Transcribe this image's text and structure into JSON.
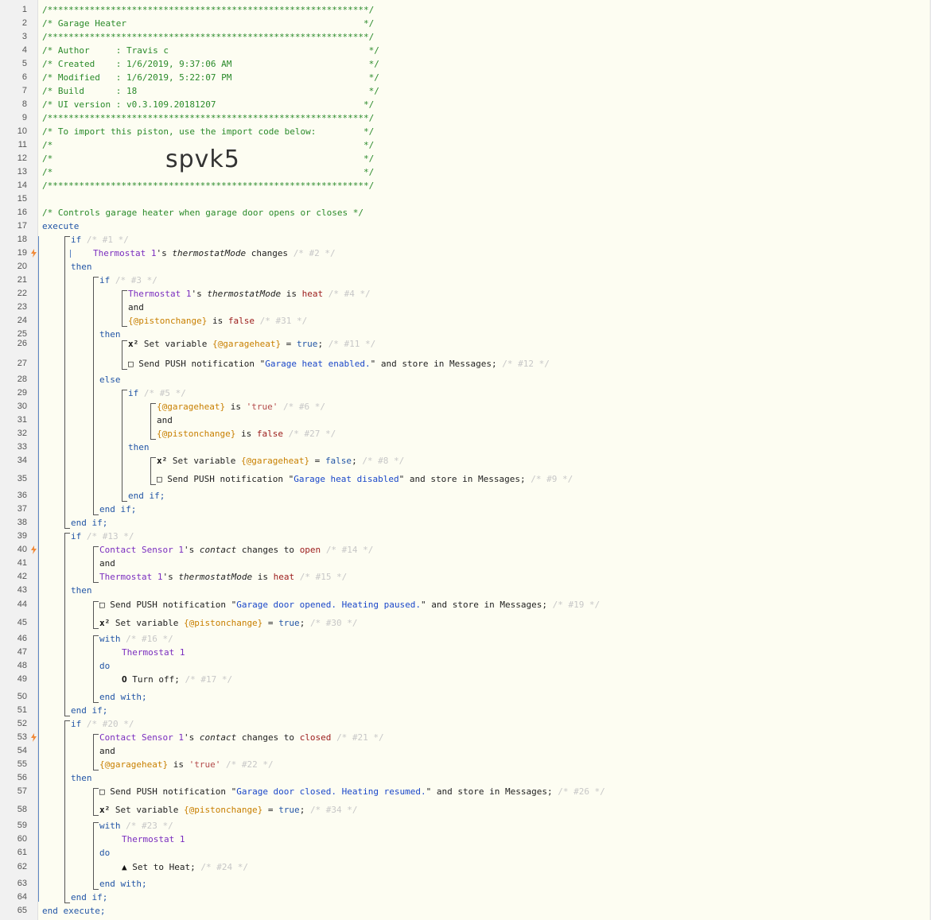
{
  "header": {
    "border": "/*************************************************************/",
    "title": "/* Garage Heater                                             */",
    "author": "/* Author     : Travis c                                      */",
    "created": "/* Created    : 1/6/2019, 9:37:06 AM                          */",
    "modified": "/* Modified   : 1/6/2019, 5:22:07 PM                          */",
    "build": "/* Build      : 18                                            */",
    "ui_version": "/* UI version : v0.3.109.20181207                            */",
    "import_note": "/* To import this piston, use the import code below:         */",
    "blank": "/*                                                           */",
    "import_code": "spvk5"
  },
  "lines": {
    "l16_comment": "/* Controls garage heater when garage door opens or closes */",
    "execute": "execute",
    "end_execute": "end execute;",
    "if": "if",
    "then": "then",
    "else": "else",
    "end_if": "end if;",
    "and": "and",
    "with": "with",
    "do": "do",
    "end_with": "end with;",
    "c1": "/* #1 */",
    "c2": "/* #2 */",
    "c3": "/* #3 */",
    "c4": "/* #4 */",
    "c31": "/* #31 */",
    "c11": "/* #11 */",
    "c12": "/* #12 */",
    "c5": "/* #5 */",
    "c6": "/* #6 */",
    "c27": "/* #27 */",
    "c8": "/* #8 */",
    "c9": "/* #9 */",
    "c13": "/* #13 */",
    "c14": "/* #14 */",
    "c15": "/* #15 */",
    "c19": "/* #19 */",
    "c30": "/* #30 */",
    "c16": "/* #16 */",
    "c17": "/* #17 */",
    "c20": "/* #20 */",
    "c21": "/* #21 */",
    "c22": "/* #22 */",
    "c26": "/* #26 */",
    "c34": "/* #34 */",
    "c23": "/* #23 */",
    "c24": "/* #24 */",
    "thermostat": "Thermostat 1",
    "contact_sensor": "Contact Sensor 1",
    "apos_s": "'s ",
    "thermostatMode": "thermostatMode",
    "contact": "contact",
    "changes": " changes ",
    "changes_to": " changes to ",
    "is": " is ",
    "heat": "heat",
    "open": "open",
    "closed": "closed",
    "false": "false",
    "true": "true",
    "str_true": "'true'",
    "pistonchange": "{@pistonchange}",
    "garageheat": "{@garageheat}",
    "set_variable": " Set variable ",
    "eq": " = ",
    "semi": "; ",
    "send_push": " Send PUSH notification ",
    "q": "\"",
    "and_store": "\" and store in Messages; ",
    "msg_enabled": "Garage heat enabled.",
    "msg_disabled": "Garage heat disabled",
    "msg_opened": "Garage door opened. Heating paused.",
    "msg_closed": "Garage door closed. Heating resumed.",
    "turn_off": " Turn off; ",
    "set_to_heat": " Set to Heat; "
  },
  "icons": {
    "variable": "x²",
    "message": "□",
    "power": "O",
    "flame": "▲"
  },
  "colors": {
    "comment": "#2a8a2a",
    "keyword": "#2255a6",
    "device": "#7a2dbf",
    "variable": "#c87f00",
    "string": "#1a47c9",
    "bolt": "#f08a3a"
  }
}
